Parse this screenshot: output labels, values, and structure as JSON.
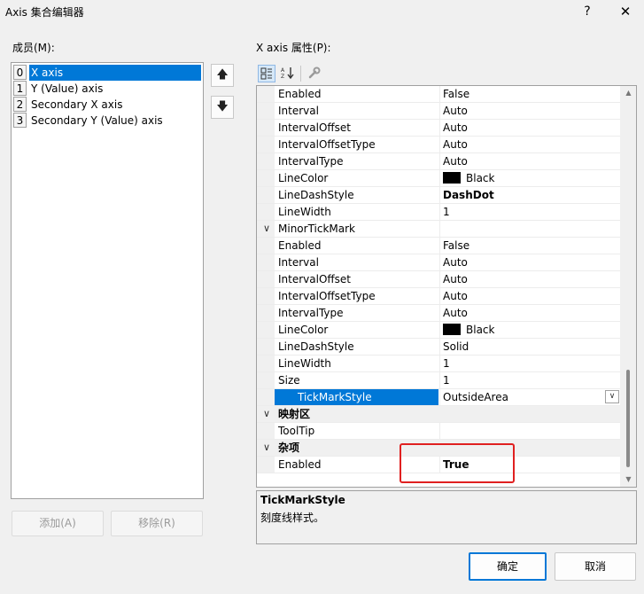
{
  "window": {
    "title": "Axis 集合编辑器",
    "help": "?",
    "close": "✕"
  },
  "members": {
    "label": "成员(M):",
    "items": [
      {
        "index": "0",
        "name": "X axis",
        "selected": true
      },
      {
        "index": "1",
        "name": "Y (Value) axis",
        "selected": false
      },
      {
        "index": "2",
        "name": "Secondary X axis",
        "selected": false
      },
      {
        "index": "3",
        "name": "Secondary Y (Value) axis",
        "selected": false
      }
    ],
    "add_label": "添加(A)",
    "remove_label": "移除(R)"
  },
  "properties": {
    "label": "X axis 属性(P):",
    "rows": [
      {
        "kind": "sub",
        "name": "Enabled",
        "value": "False"
      },
      {
        "kind": "sub",
        "name": "Interval",
        "value": "Auto"
      },
      {
        "kind": "sub",
        "name": "IntervalOffset",
        "value": "Auto"
      },
      {
        "kind": "sub",
        "name": "IntervalOffsetType",
        "value": "Auto"
      },
      {
        "kind": "sub",
        "name": "IntervalType",
        "value": "Auto"
      },
      {
        "kind": "sub",
        "name": "LineColor",
        "value": "Black",
        "swatch": "#000000"
      },
      {
        "kind": "sub",
        "name": "LineDashStyle",
        "value": "DashDot",
        "bold": true
      },
      {
        "kind": "sub",
        "name": "LineWidth",
        "value": "1"
      },
      {
        "kind": "expand",
        "name": "MinorTickMark",
        "value": ""
      },
      {
        "kind": "sub",
        "name": "Enabled",
        "value": "False"
      },
      {
        "kind": "sub",
        "name": "Interval",
        "value": "Auto"
      },
      {
        "kind": "sub",
        "name": "IntervalOffset",
        "value": "Auto"
      },
      {
        "kind": "sub",
        "name": "IntervalOffsetType",
        "value": "Auto"
      },
      {
        "kind": "sub",
        "name": "IntervalType",
        "value": "Auto"
      },
      {
        "kind": "sub",
        "name": "LineColor",
        "value": "Black",
        "swatch": "#000000"
      },
      {
        "kind": "sub",
        "name": "LineDashStyle",
        "value": "Solid"
      },
      {
        "kind": "sub",
        "name": "LineWidth",
        "value": "1"
      },
      {
        "kind": "sub",
        "name": "Size",
        "value": "1"
      },
      {
        "kind": "sub",
        "name": "TickMarkStyle",
        "value": "OutsideArea",
        "selected": true,
        "dropdown": true
      },
      {
        "kind": "cat",
        "name": "映射区",
        "value": ""
      },
      {
        "kind": "top",
        "name": "ToolTip",
        "value": ""
      },
      {
        "kind": "cat",
        "name": "杂项",
        "value": ""
      },
      {
        "kind": "top",
        "name": "Enabled",
        "value": "True",
        "bold": true
      }
    ]
  },
  "description": {
    "title": "TickMarkStyle",
    "text": "刻度线样式。"
  },
  "buttons": {
    "ok": "确定",
    "cancel": "取消"
  },
  "colors": {
    "selection": "#0078d7",
    "highlight_box": "#e02020"
  }
}
